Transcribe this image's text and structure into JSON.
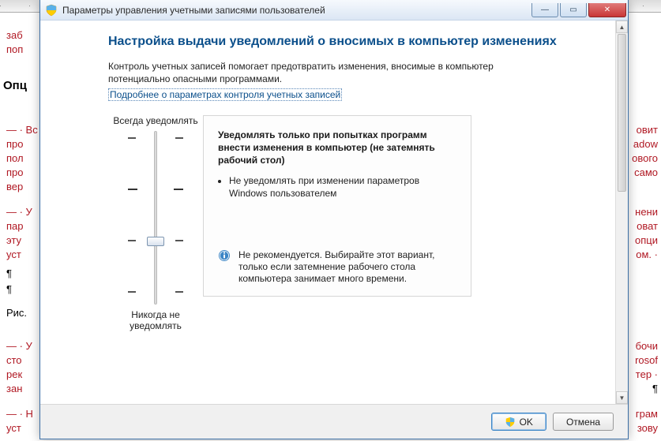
{
  "window": {
    "title": "Параметры управления учетными записями пользователей",
    "buttons": {
      "min": "—",
      "max": "▭",
      "close": "✕"
    }
  },
  "page": {
    "heading": "Настройка выдачи уведомлений о вносимых в компьютер изменениях",
    "intro": "Контроль учетных записей помогает предотвратить изменения, вносимые в компьютер потенциально опасными программами.",
    "link": "Подробнее о параметрах контроля учетных записей"
  },
  "slider": {
    "top_label": "Всегда уведомлять",
    "bottom_label": "Никогда не уведомлять",
    "level_count": 4,
    "current_level": 1
  },
  "panel": {
    "title": "Уведомлять только при попытках программ внести изменения в компьютер (не затемнять рабочий стол)",
    "bullet": "Не уведомлять при изменении параметров Windows пользователем",
    "info": "Не рекомендуется. Выбирайте этот вариант, только если затемнение рабочего стола компьютера занимает много времени."
  },
  "footer": {
    "ok": "OK",
    "cancel": "Отмена"
  },
  "bg_doc": {
    "heading": "Опц",
    "fig": "Рис.",
    "lines": [
      "заб",
      "поп",
      "— · Вс",
      "про",
      "пол",
      "про",
      "вер",
      "— · У",
      "пар",
      "эту",
      "уст",
      "¶",
      "¶",
      "— · У",
      "сто",
      "рек",
      "зан",
      "— · Н",
      "уст"
    ],
    "right_lines": [
      "овит",
      "adow",
      "ового",
      "само",
      "нени",
      "оват",
      "опци",
      "ом. ·",
      "бочи",
      "rosof",
      "тер ·",
      "¶",
      "грам",
      "зову"
    ]
  }
}
